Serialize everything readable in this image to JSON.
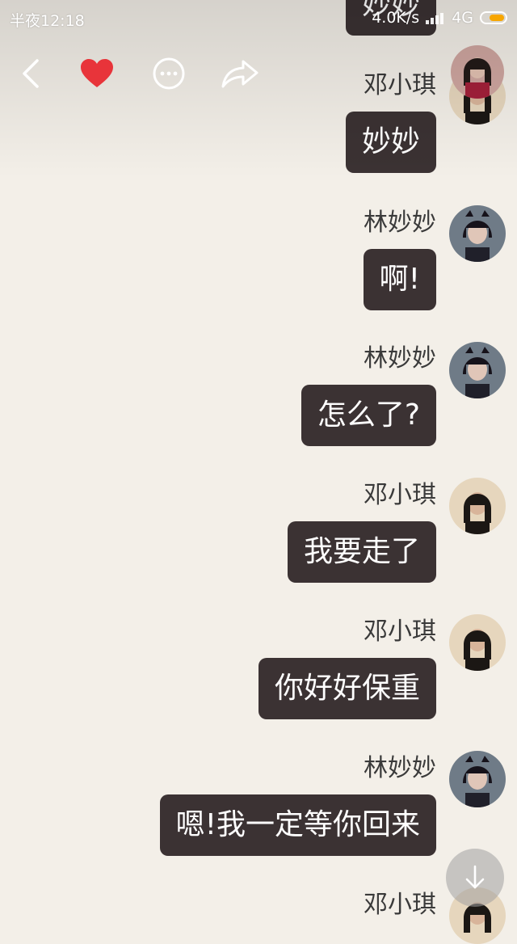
{
  "status_bar": {
    "time": "半夜12:18",
    "network_speed": "4.0K/s",
    "network_type": "4G"
  },
  "toolbar": {
    "icons": [
      "back-icon",
      "heart-icon",
      "more-icon",
      "share-icon"
    ],
    "heart_color": "#e8343a"
  },
  "chat": {
    "top_partial_bubble": "妙妙",
    "messages": [
      {
        "sender": "邓小琪",
        "text": "妙妙"
      },
      {
        "sender": "林妙妙",
        "text": "啊!"
      },
      {
        "sender": "林妙妙",
        "text": "怎么了?"
      },
      {
        "sender": "邓小琪",
        "text": "我要走了"
      },
      {
        "sender": "邓小琪",
        "text": "你好好保重"
      },
      {
        "sender": "林妙妙",
        "text": "嗯!我一定等你回来"
      },
      {
        "sender": "邓小琪",
        "text": ""
      }
    ]
  },
  "colors": {
    "background": "#f3efe8",
    "bubble": "#3b3233",
    "bubble_text": "#ffffff"
  }
}
